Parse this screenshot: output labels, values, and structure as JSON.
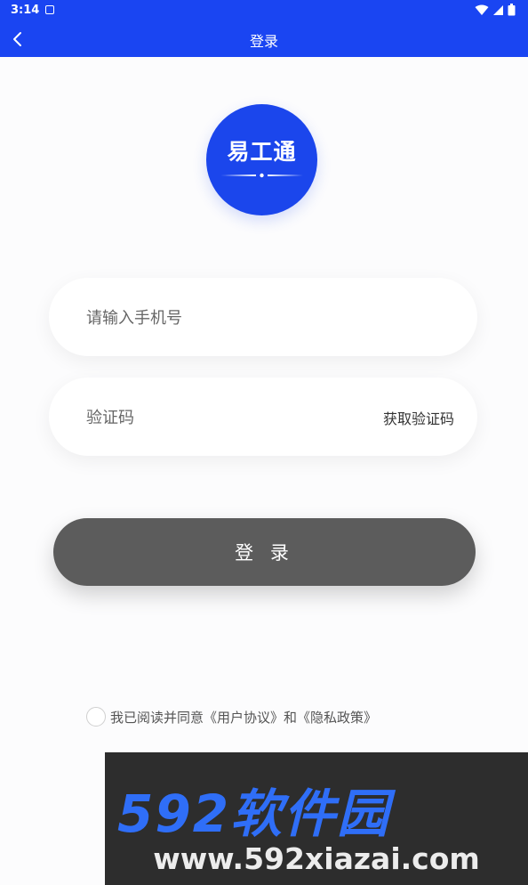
{
  "status_bar": {
    "time": "3:14"
  },
  "nav": {
    "title": "登录"
  },
  "logo": {
    "text": "易工通"
  },
  "phone_field": {
    "placeholder": "请输入手机号"
  },
  "code_field": {
    "placeholder": "验证码",
    "get_code_label": "获取验证码"
  },
  "login_button": {
    "label": "登 录"
  },
  "agreement": {
    "prefix": "我已阅读并同意",
    "user_agreement": "《用户协议》",
    "and": "和",
    "privacy_policy": "《隐私政策》"
  },
  "watermark": {
    "line1": "592软件园",
    "line2": "www.592xiazai.com"
  },
  "colors": {
    "brand_blue": "#1a45f2",
    "button_gray": "#5c5c5c"
  }
}
